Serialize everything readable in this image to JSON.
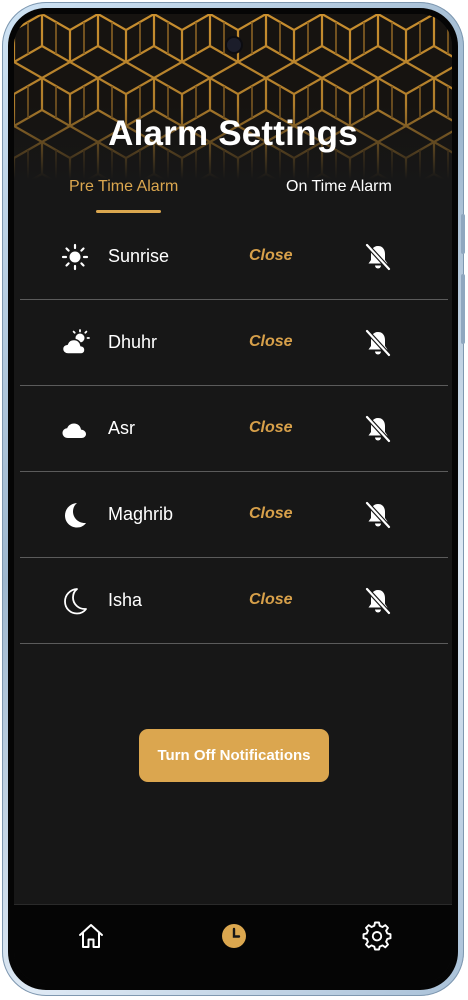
{
  "header": {
    "title": "Alarm Settings"
  },
  "tabs": [
    {
      "label": "Pre Time Alarm",
      "active": true
    },
    {
      "label": "On Time Alarm",
      "active": false
    }
  ],
  "prayers": [
    {
      "name": "Sunrise",
      "status": "Close",
      "icon": "sun-icon",
      "alarm_icon": "bell-off-icon"
    },
    {
      "name": "Dhuhr",
      "status": "Close",
      "icon": "partly-cloudy-sun-icon",
      "alarm_icon": "bell-off-icon"
    },
    {
      "name": "Asr",
      "status": "Close",
      "icon": "cloud-icon",
      "alarm_icon": "bell-off-icon"
    },
    {
      "name": "Maghrib",
      "status": "Close",
      "icon": "moon-filled-icon",
      "alarm_icon": "bell-off-icon"
    },
    {
      "name": "Isha",
      "status": "Close",
      "icon": "moon-outline-icon",
      "alarm_icon": "bell-off-icon"
    }
  ],
  "actions": {
    "turn_off_label": "Turn Off Notifications"
  },
  "bottom_nav": [
    {
      "name": "home",
      "icon": "home-icon",
      "active": false
    },
    {
      "name": "clock",
      "icon": "clock-icon",
      "active": true
    },
    {
      "name": "settings",
      "icon": "gear-icon",
      "active": false
    }
  ],
  "colors": {
    "accent": "#dba74f",
    "background": "#171717",
    "nav_background": "#050505",
    "divider": "#5b5b5b"
  }
}
